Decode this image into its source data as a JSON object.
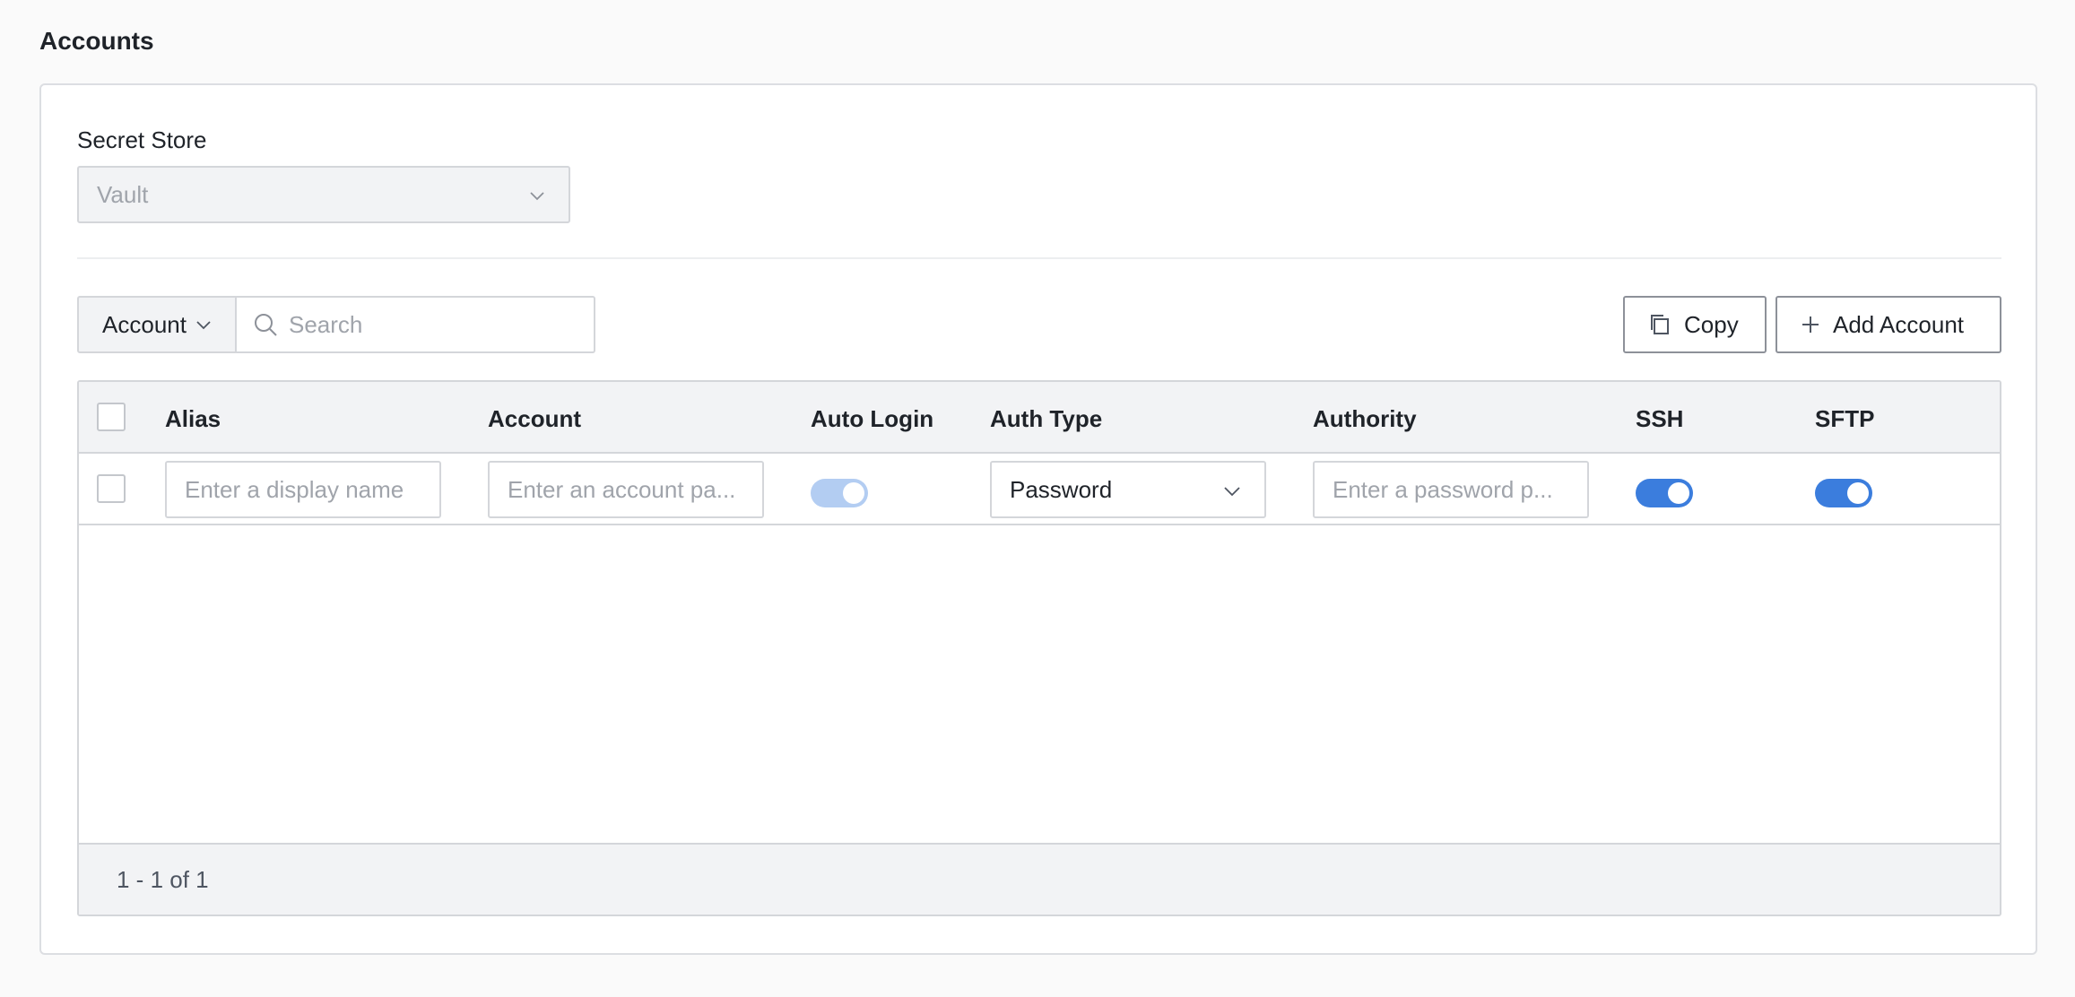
{
  "section": {
    "title": "Accounts"
  },
  "secret_store": {
    "label": "Secret Store",
    "value": "Vault"
  },
  "toolbar": {
    "filter_value": "Account",
    "search_placeholder": "Search",
    "copy_label": "Copy",
    "add_label": "Add Account"
  },
  "table": {
    "headers": {
      "alias": "Alias",
      "account": "Account",
      "auto_login": "Auto Login",
      "auth_type": "Auth Type",
      "authority": "Authority",
      "ssh": "SSH",
      "sftp": "SFTP"
    },
    "rows": [
      {
        "alias_placeholder": "Enter a display name",
        "account_placeholder": "Enter an account pa...",
        "auto_login": true,
        "auto_login_disabled": true,
        "auth_type": "Password",
        "authority_placeholder": "Enter a password p...",
        "ssh": true,
        "sftp": true
      }
    ],
    "pagination": "1 - 1 of 1"
  },
  "colors": {
    "toggle_on": "#3b7ddd",
    "toggle_disabled": "#b3cdf2"
  }
}
